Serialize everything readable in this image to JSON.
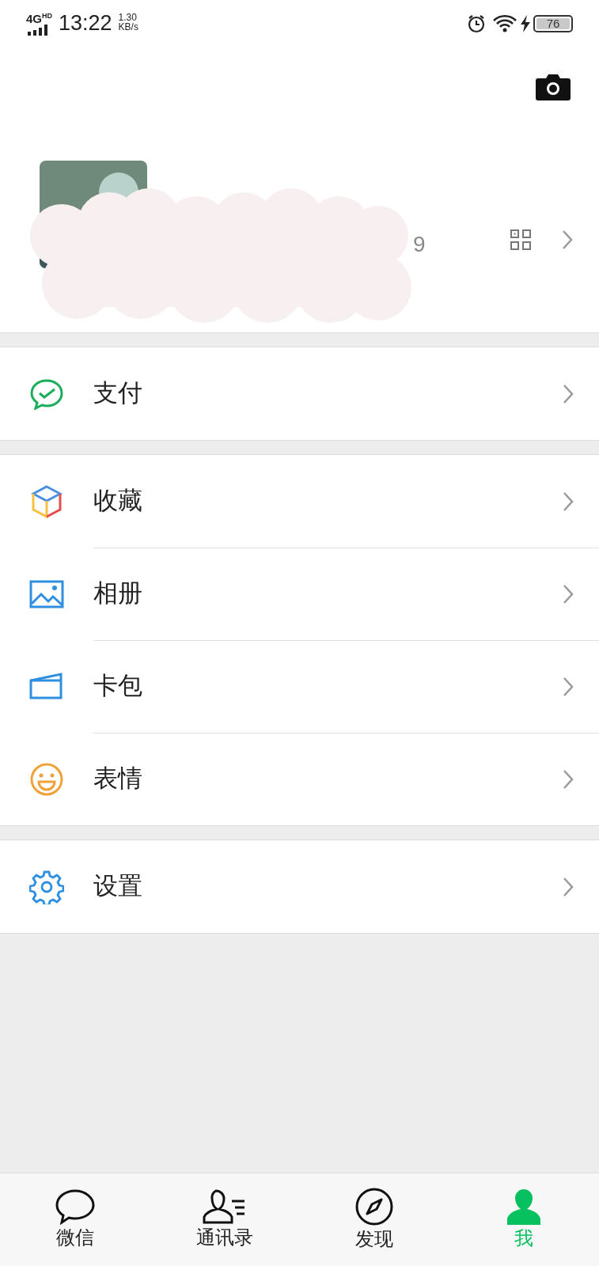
{
  "status_bar": {
    "network": "4G",
    "network_sup": "HD",
    "time": "13:22",
    "speed": "1.30",
    "speed_unit": "KB/s",
    "battery": "76"
  },
  "profile": {
    "id_fragment": "9"
  },
  "groups": [
    [
      {
        "kind": "pay",
        "label": "支付"
      }
    ],
    [
      {
        "kind": "favorites",
        "label": "收藏"
      },
      {
        "kind": "album",
        "label": "相册"
      },
      {
        "kind": "cards",
        "label": "卡包"
      },
      {
        "kind": "stickers",
        "label": "表情"
      }
    ],
    [
      {
        "kind": "settings",
        "label": "设置"
      }
    ]
  ],
  "tabs": [
    {
      "kind": "chats",
      "label": "微信",
      "selected": false
    },
    {
      "kind": "contacts",
      "label": "通讯录",
      "selected": false
    },
    {
      "kind": "discover",
      "label": "发现",
      "selected": false
    },
    {
      "kind": "me",
      "label": "我",
      "selected": true
    }
  ]
}
